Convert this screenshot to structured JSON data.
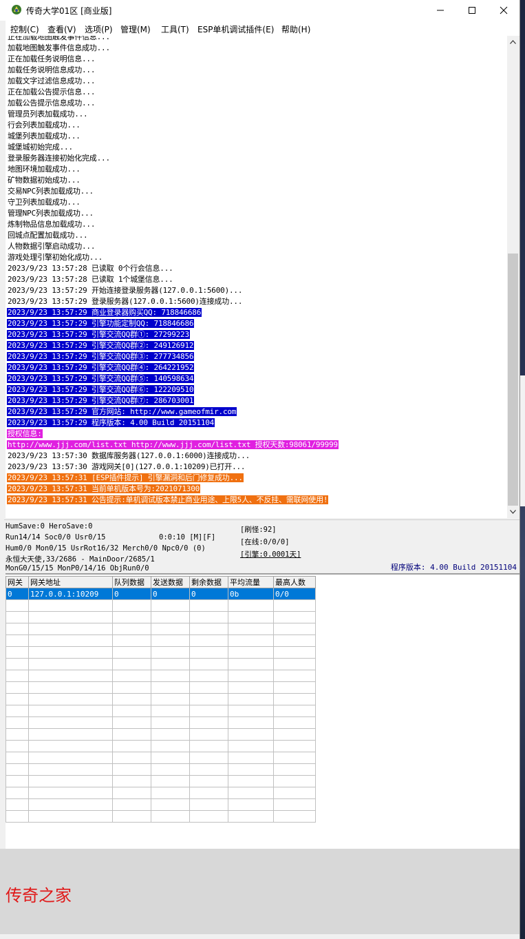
{
  "window": {
    "title": "传奇大学01区 [商业版]"
  },
  "menu": [
    "控制(C)",
    "查看(V)",
    "选项(P)",
    "管理(M)",
    "工具(T)",
    "ESP单机调试插件(E)",
    "帮助(H)"
  ],
  "log": [
    {
      "text": "正在加载地图触发事件信息...",
      "style": "plain"
    },
    {
      "text": "加载地图触发事件信息成功...",
      "style": "plain"
    },
    {
      "text": "正在加载任务说明信息...",
      "style": "plain"
    },
    {
      "text": "加载任务说明信息成功...",
      "style": "plain"
    },
    {
      "text": "加载文字过滤信息成功...",
      "style": "plain"
    },
    {
      "text": "正在加载公告提示信息...",
      "style": "plain"
    },
    {
      "text": "加载公告提示信息成功...",
      "style": "plain"
    },
    {
      "text": "管理员列表加载成功...",
      "style": "plain"
    },
    {
      "text": "行会列表加载成功...",
      "style": "plain"
    },
    {
      "text": "城堡列表加载成功...",
      "style": "plain"
    },
    {
      "text": "城堡城初始完成...",
      "style": "plain"
    },
    {
      "text": "登录服务器连接初始化完成...",
      "style": "plain"
    },
    {
      "text": "地图环境加载成功...",
      "style": "plain"
    },
    {
      "text": "矿物数据初始成功...",
      "style": "plain"
    },
    {
      "text": "交易NPC列表加载成功...",
      "style": "plain"
    },
    {
      "text": "守卫列表加载成功...",
      "style": "plain"
    },
    {
      "text": "管理NPC列表加载成功...",
      "style": "plain"
    },
    {
      "text": "炼制物品信息加载成功...",
      "style": "plain"
    },
    {
      "text": "回城点配置加载成功...",
      "style": "plain"
    },
    {
      "text": "人物数据引擎启动成功...",
      "style": "plain"
    },
    {
      "text": "游戏处理引擎初始化成功...",
      "style": "plain"
    },
    {
      "text": "2023/9/23 13:57:28 已读取 0个行会信息...",
      "style": "plain"
    },
    {
      "text": "2023/9/23 13:57:28 已读取 1个城堡信息...",
      "style": "plain"
    },
    {
      "text": "2023/9/23 13:57:29 开始连接登录服务器(127.0.0.1:5600)...",
      "style": "plain"
    },
    {
      "text": "2023/9/23 13:57:29 登录服务器(127.0.0.1:5600)连接成功...",
      "style": "plain"
    },
    {
      "text": "2023/9/23 13:57:29 商业登录器购买QQ: 718846686",
      "style": "blue"
    },
    {
      "text": "2023/9/23 13:57:29 引擎功能定制QQ: 718846686",
      "style": "blue"
    },
    {
      "text": "2023/9/23 13:57:29 引擎交流QQ群①: 27299223",
      "style": "blue"
    },
    {
      "text": "2023/9/23 13:57:29 引擎交流QQ群②: 249126912",
      "style": "blue"
    },
    {
      "text": "2023/9/23 13:57:29 引擎交流QQ群③: 277734856",
      "style": "blue"
    },
    {
      "text": "2023/9/23 13:57:29 引擎交流QQ群④: 264221952",
      "style": "blue"
    },
    {
      "text": "2023/9/23 13:57:29 引擎交流QQ群⑤: 140598634",
      "style": "blue"
    },
    {
      "text": "2023/9/23 13:57:29 引擎交流QQ群⑥: 122209510",
      "style": "blue"
    },
    {
      "text": "2023/9/23 13:57:29 引擎交流QQ群⑦: 286703001",
      "style": "blue"
    },
    {
      "text": "2023/9/23 13:57:29 官方网站: http://www.gameofmir.com",
      "style": "blue"
    },
    {
      "text": "2023/9/23 13:57:29 程序版本: 4.00 Build 20151104",
      "style": "blue"
    },
    {
      "text": "授权信息:",
      "style": "magenta"
    },
    {
      "text": "http://www.jjj.com/list.txt http://www.jjj.com/list.txt 授权天数:98061/99999",
      "style": "magenta"
    },
    {
      "text": "2023/9/23 13:57:30 数据库服务器(127.0.0.1:6000)连接成功...",
      "style": "plain"
    },
    {
      "text": "2023/9/23 13:57:30 游戏网关[0](127.0.0.1:10209)已打开...",
      "style": "plain"
    },
    {
      "text": "2023/9/23 13:57:31 [ESP插件提示] 引擎漏洞和后门修复成功...",
      "style": "orange"
    },
    {
      "text": "2023/9/23 13:57:31 当前单机版本号为:2021071300",
      "style": "orange"
    },
    {
      "text": "2023/9/23 13:57:31 公告提示:单机调试版本禁止商业用途、上限5人、不反挂、需联网使用!",
      "style": "orange"
    }
  ],
  "status": {
    "humsave": "HumSave:0 HeroSave:0",
    "run": "Run14/14 Soc0/0 Usr0/15",
    "timer": "0:0:10 [M][F]",
    "hum": "Hum0/0 Mon0/15 UsrRot16/32 Merch0/0 Npc0/0 (0)",
    "map": "永恒大天使,33/2686 - MainDoor/2685/1",
    "mon": "MonG0/15/15 MonP0/14/16 ObjRun0/0",
    "refresh": "[刷怪:92]",
    "online": "[在线:0/0/0]",
    "engine": "[引擎:0.0001天]",
    "build": "程序版本: 4.00 Build 20151104"
  },
  "grid": {
    "columns": [
      "网关",
      "网关地址",
      "队列数据",
      "发送数据",
      "剩余数据",
      "平均流量",
      "最高人数"
    ],
    "rows": [
      [
        "0",
        "127.0.0.1:10209",
        "0",
        "0",
        "0",
        "0b",
        "0/0"
      ]
    ]
  },
  "watermark": "传奇之家",
  "colors": {
    "highlight_blue": "#0000cc",
    "highlight_magenta": "#e020e0",
    "highlight_orange": "#f07010",
    "selection": "#0078d7",
    "watermark": "#e01818"
  }
}
